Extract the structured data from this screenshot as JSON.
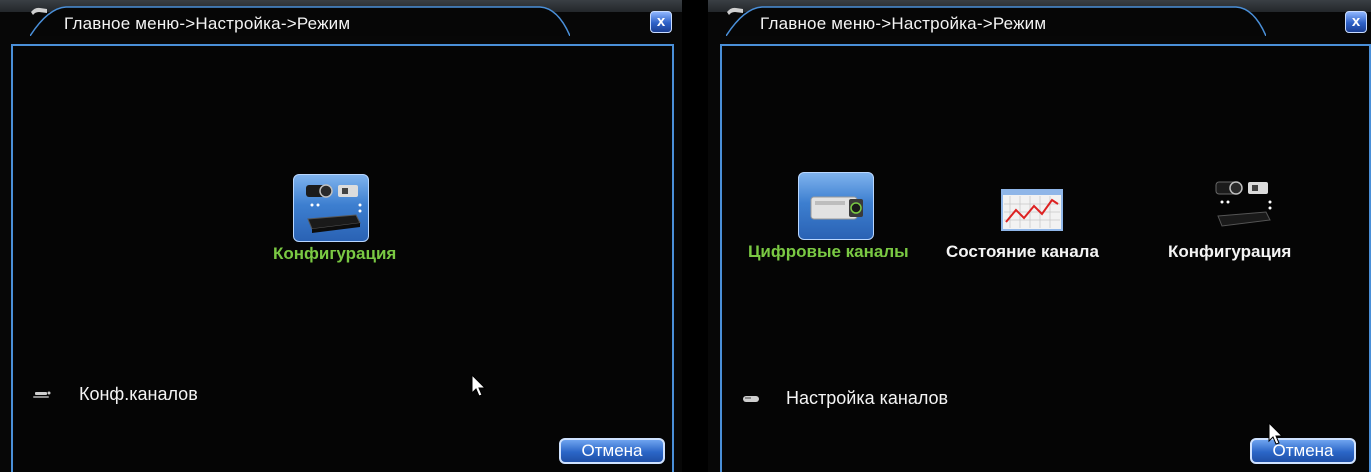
{
  "left_window": {
    "title": "Главное меню->Настройка->Режим",
    "close_label": "x",
    "tiles": [
      {
        "label": "Конфигурация",
        "icon": "camera-dvr-icon",
        "selected": true
      }
    ],
    "bottom_item": {
      "label": "Конф.каналов",
      "icon": "channel-icon"
    },
    "cancel_label": "Отмена"
  },
  "right_window": {
    "title": "Главное меню->Настройка->Режим",
    "close_label": "x",
    "tiles": [
      {
        "label": "Цифровые каналы",
        "icon": "ip-camera-icon",
        "selected": true
      },
      {
        "label": "Состояние канала",
        "icon": "chart-icon",
        "selected": false
      },
      {
        "label": "Конфигурация",
        "icon": "camera-dvr-icon",
        "selected": false
      }
    ],
    "bottom_item": {
      "label": "Настройка каналов",
      "icon": "channel-icon"
    },
    "cancel_label": "Отмена"
  },
  "colors": {
    "frame_border": "#4a8fd8",
    "selected_label": "#7ac943",
    "label": "#f4f4f4",
    "button_blue": "#2b66c7"
  }
}
